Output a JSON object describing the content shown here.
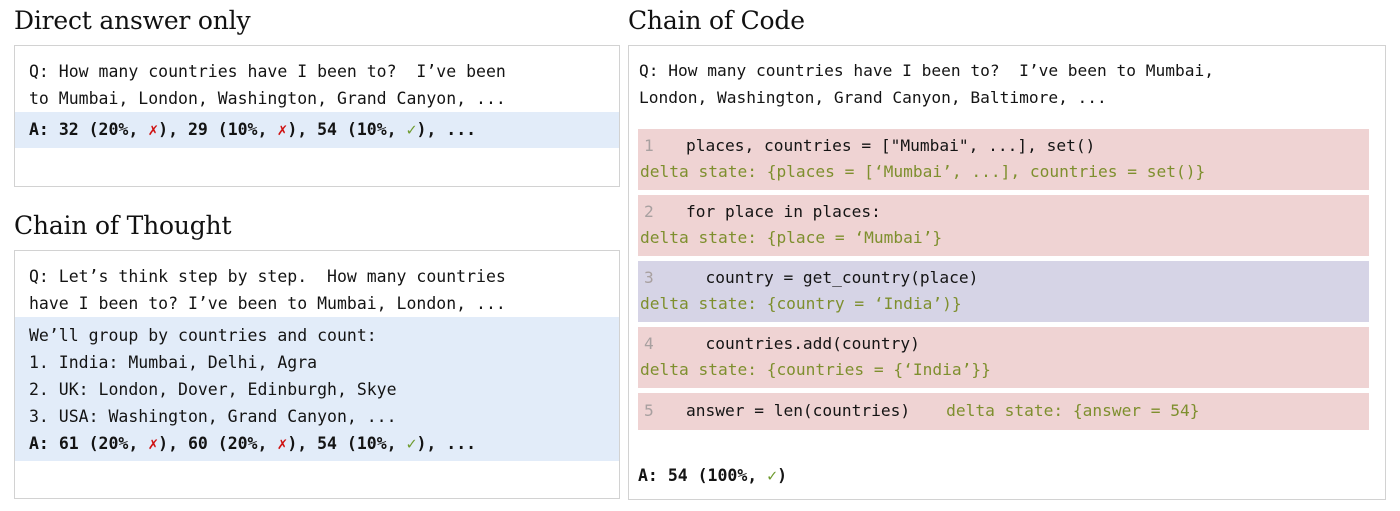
{
  "headings": {
    "direct_answer": "Direct answer only",
    "chain_of_thought": "Chain of Thought",
    "chain_of_code": "Chain of Code"
  },
  "direct_answer": {
    "question_line1": "Q: How many countries have I been to?  I’ve been",
    "question_line2": "to Mumbai, London, Washington, Grand Canyon, ...",
    "answer": {
      "label": "A: ",
      "part1": "32 (20%, ",
      "x1": "✗",
      "part2": "), 29 (10%, ",
      "x2": "✗",
      "part3": "), 54 (10%, ",
      "check": "✓",
      "part4": "), ..."
    }
  },
  "chain_of_thought": {
    "question_line1": "Q: Let’s think step by step.  How many countries",
    "question_line2": "have I been to? I’ve been to Mumbai, London, ...",
    "body_lines": [
      "We’ll group by countries and count:",
      "1. India: Mumbai, Delhi, Agra",
      "2. UK: London, Dover, Edinburgh, Skye",
      "3. USA: Washington, Grand Canyon, ..."
    ],
    "answer": {
      "label": "A: ",
      "part1": "61 (20%, ",
      "x1": "✗",
      "part2": "), 60 (20%, ",
      "x2": "✗",
      "part3": "), 54 (10%, ",
      "check": "✓",
      "part4": "), ..."
    }
  },
  "chain_of_code": {
    "question_line1": "Q: How many countries have I been to?  I’ve been to Mumbai,",
    "question_line2": "London, Washington, Grand Canyon, Baltimore, ...",
    "rows": [
      {
        "lineno": "1",
        "code": "   places, countries = [\"Mumbai\", ...], set()",
        "delta": "delta state: {places = [‘Mumbai’, ...], countries = set()}",
        "highlight": "pink"
      },
      {
        "lineno": "2",
        "code": "   for place in places:",
        "delta": "delta state: {place = ‘Mumbai’}",
        "highlight": "pink"
      },
      {
        "lineno": "3",
        "code": "     country = get_country(place)",
        "delta": "delta state: {country = ‘India’)}",
        "highlight": "purple"
      },
      {
        "lineno": "4",
        "code": "     countries.add(country)",
        "delta": "delta state: {countries = {‘India’}}",
        "highlight": "pink"
      },
      {
        "lineno": "5",
        "code": "   answer = len(countries)",
        "delta": "delta state: {answer = 54}",
        "highlight": "pink",
        "inline": true
      }
    ],
    "final_answer": {
      "label": "A: ",
      "value": "54 (100%, ",
      "check": "✓",
      "tail": ")"
    }
  },
  "colors": {
    "pink_row": "#efd3d3",
    "purple_row": "#d6d4e6",
    "blue_highlight": "#e2ecf9",
    "delta_green": "#7e8f2e",
    "check_green": "#6f9b2f",
    "cross_red": "#cf1111",
    "lineno_gray": "#a8a0a0",
    "panel_border": "#d2d2d2"
  }
}
